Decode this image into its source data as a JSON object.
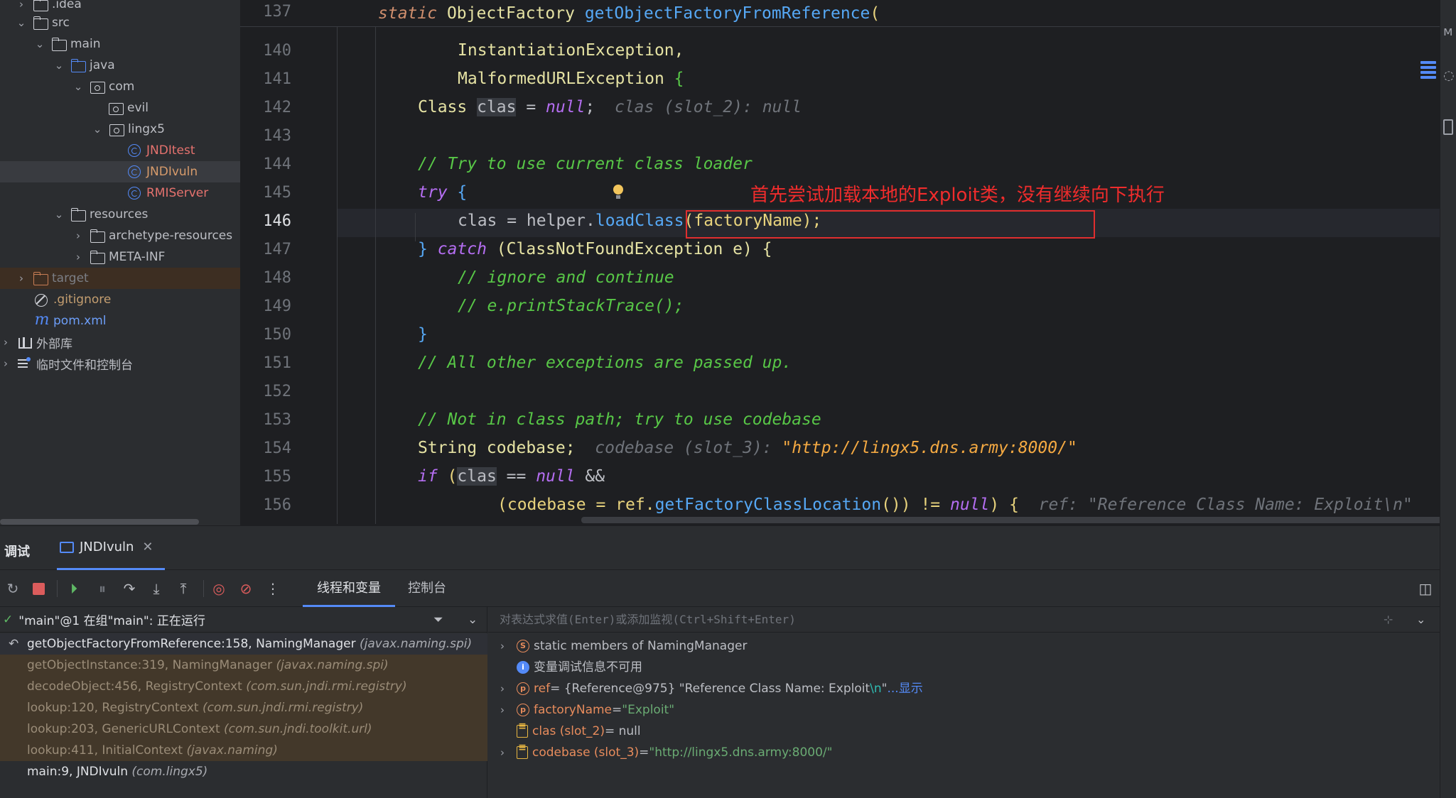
{
  "project_tree": {
    "items": [
      {
        "label": ".idea"
      },
      {
        "label": "src"
      },
      {
        "label": "main"
      },
      {
        "label": "java"
      },
      {
        "label": "com"
      },
      {
        "label": "evil"
      },
      {
        "label": "lingx5"
      },
      {
        "label": "JNDItest"
      },
      {
        "label": "JNDIvuln"
      },
      {
        "label": "RMIServer"
      },
      {
        "label": "resources"
      },
      {
        "label": "archetype-resources"
      },
      {
        "label": "META-INF"
      },
      {
        "label": "target"
      },
      {
        "label": ".gitignore"
      },
      {
        "label": "pom.xml"
      },
      {
        "label": "外部库"
      },
      {
        "label": "临时文件和控制台"
      }
    ]
  },
  "editor": {
    "sticky_line_number": "137",
    "sticky_code": {
      "kw": "static",
      "type": " ObjectFactory ",
      "fn": "getObjectFactoryFromReference",
      "paren": "("
    },
    "line_numbers": [
      "140",
      "141",
      "142",
      "143",
      "144",
      "145",
      "146",
      "147",
      "148",
      "149",
      "150",
      "151",
      "152",
      "153",
      "154",
      "155",
      "156"
    ],
    "lines": {
      "l140": "InstantiationException,",
      "l141_a": "MalformedURLException ",
      "l141_b": "{",
      "l142_a": "Class ",
      "l142_var": "clas",
      "l142_b": " = ",
      "l142_null": "null",
      "l142_c": ";",
      "l142_hint": "clas (slot_2): null",
      "l144": "// Try to use current class loader",
      "l145_kw": "try",
      "l145_b": " {",
      "l146_a": "clas = helper.",
      "l146_fn": "loadClass",
      "l146_b": "(factoryName);",
      "l147_a": "} ",
      "l147_kw": "catch",
      "l147_b": " (ClassNotFoundException e) {",
      "l148": "// ignore and continue",
      "l149": "// e.printStackTrace();",
      "l150": "}",
      "l151": "// All other exceptions are passed up.",
      "l153": "// Not in class path; try to use codebase",
      "l154_a": "String codebase;",
      "l154_hint": "codebase (slot_3): ",
      "l154_hintval": "\"http://lingx5.dns.army:8000/\"",
      "l155_kw": "if",
      "l155_a": " (",
      "l155_var": "clas",
      "l155_b": " == ",
      "l155_null": "null",
      "l155_c": " &&",
      "l156_a": "(codebase = ref.",
      "l156_fn": "getFactoryClassLocation",
      "l156_b": "()) != ",
      "l156_null": "null",
      "l156_c": ") {",
      "l156_hint": "ref: \"Reference Class Name: Exploit\\n\""
    },
    "annotation": "首先尝试加载本地的Exploit类，没有继续向下执行"
  },
  "debug": {
    "title": "调试",
    "run_tab": "JNDIvuln",
    "subtabs": [
      "线程和变量",
      "控制台"
    ],
    "thread_status": "\"main\"@1 在组\"main\": 正在运行",
    "frames": [
      {
        "method": "getObjectFactoryFromReference:158, NamingManager ",
        "pkg": "(javax.naming.spi)"
      },
      {
        "method": "getObjectInstance:319, NamingManager ",
        "pkg": "(javax.naming.spi)"
      },
      {
        "method": "decodeObject:456, RegistryContext ",
        "pkg": "(com.sun.jndi.rmi.registry)"
      },
      {
        "method": "lookup:120, RegistryContext ",
        "pkg": "(com.sun.jndi.rmi.registry)"
      },
      {
        "method": "lookup:203, GenericURLContext ",
        "pkg": "(com.sun.jndi.toolkit.url)"
      },
      {
        "method": "lookup:411, InitialContext ",
        "pkg": "(javax.naming)"
      },
      {
        "method": "main:9, JNDIvuln ",
        "pkg": "(com.lingx5)"
      }
    ],
    "eval_placeholder": "对表达式求值(Enter)或添加监视(Ctrl+Shift+Enter)",
    "variables": {
      "static_members": "static members of NamingManager",
      "no_debug_info": "变量调试信息不可用",
      "ref_name": "ref",
      "ref_eq": " = {Reference@975} \"Reference Class Name: Exploit",
      "ref_nl": "\\n",
      "ref_end": "\"",
      "ref_more": "...显示",
      "factory_name": "factoryName",
      "factory_eq": " = ",
      "factory_val": "\"Exploit\"",
      "clas_name": "clas (slot_2)",
      "clas_eq": " = null",
      "codebase_name": "codebase (slot_3)",
      "codebase_eq": " = ",
      "codebase_val": "\"http://lingx5.dns.army:8000/\""
    }
  }
}
